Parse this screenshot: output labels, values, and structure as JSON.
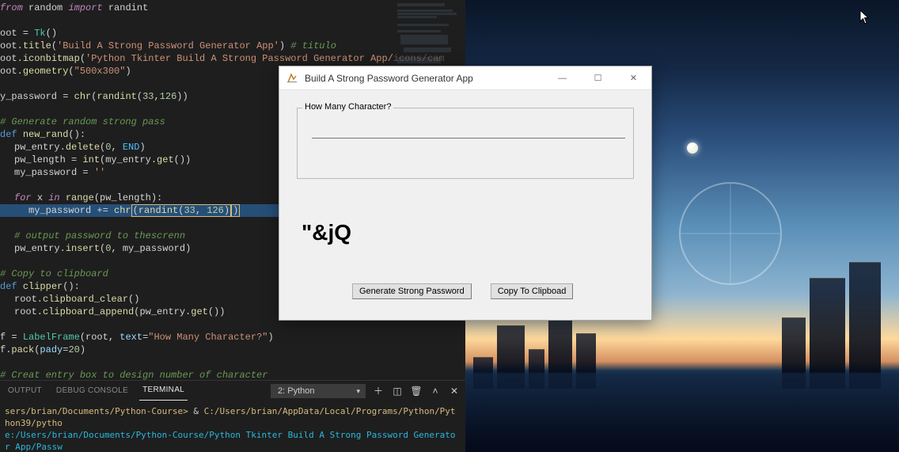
{
  "code": {
    "l1": {
      "from": "from",
      "mod": "random",
      "imp": "import",
      "name": "randint"
    },
    "l3": {
      "v": "oot",
      "cls": "Tk"
    },
    "l4": {
      "v": "oot.",
      "fn": "title",
      "s": "'Build A Strong Password Generator App'",
      "c": "# titulo"
    },
    "l5": {
      "v": "oot.",
      "fn": "iconbitmap",
      "s": "'Python Tkinter Build A Strong Password Generator App/icons/cam"
    },
    "l6": {
      "v": "oot.",
      "fn": "geometry",
      "s": "\"500x300\""
    },
    "l8": {
      "v": "y_password",
      "fn": "chr",
      "fn2": "randint",
      "n1": "33",
      "n2": "126"
    },
    "l10": {
      "c": "# Generate random strong pass"
    },
    "l11": {
      "def": "def",
      "name": "new_rand"
    },
    "l12": {
      "v": "pw_entry.",
      "fn": "delete",
      "n": "0",
      "c": "END"
    },
    "l13": {
      "v": "pw_length",
      "fn": "int",
      "v2": "my_entry.",
      "fn2": "get"
    },
    "l14": {
      "v": "my_password",
      "s": "''"
    },
    "l16": {
      "for": "for",
      "x": "x",
      "in": "in",
      "fn": "range",
      "v": "pw_length"
    },
    "l17": {
      "v": "my_password",
      "fn": "chr",
      "fn2": "randint",
      "n1": "33",
      "n2": "126"
    },
    "l19": {
      "c": "# output password to thescrenn"
    },
    "l20": {
      "v": "pw_entry.",
      "fn": "insert",
      "n": "0",
      "v2": "my_password"
    },
    "l22": {
      "c": "# Copy to clipboard"
    },
    "l23": {
      "def": "def",
      "name": "clipper"
    },
    "l24": {
      "v": "root.",
      "fn": "clipboard_clear"
    },
    "l25": {
      "v": "root.",
      "fn": "clipboard_append",
      "v2": "pw_entry.",
      "fn2": "get"
    },
    "l27": {
      "v": "f",
      "cls": "LabelFrame",
      "v2": "root",
      "kw": "text",
      "s": "\"How Many Character?\""
    },
    "l28": {
      "v": "f.",
      "fn": "pack",
      "kw": "pady",
      "n": "20"
    },
    "l30": {
      "c": "# Creat entry box to design number of character"
    }
  },
  "panel": {
    "tabs": {
      "output": "OUTPUT",
      "debug": "DEBUG CONSOLE",
      "terminal": "TERMINAL"
    },
    "select": "2: Python"
  },
  "terminal": {
    "line1_a": "sers/brian/Documents/Python-Course> ",
    "line1_b": "& ",
    "line1_c": "C:/Users/brian/AppData/Local/Programs/Python/Python39/pytho",
    "line2": "e:/Users/brian/Documents/Python-Course/Python Tkinter Build A Strong Password Generator App/Passw"
  },
  "tk": {
    "title": "Build A Strong Password Generator App",
    "frame_label": "How Many Character?",
    "entry_value": "",
    "output": "\"&jQ",
    "btn_generate": "Generate Strong Password",
    "btn_copy": "Copy To Clipboad"
  }
}
